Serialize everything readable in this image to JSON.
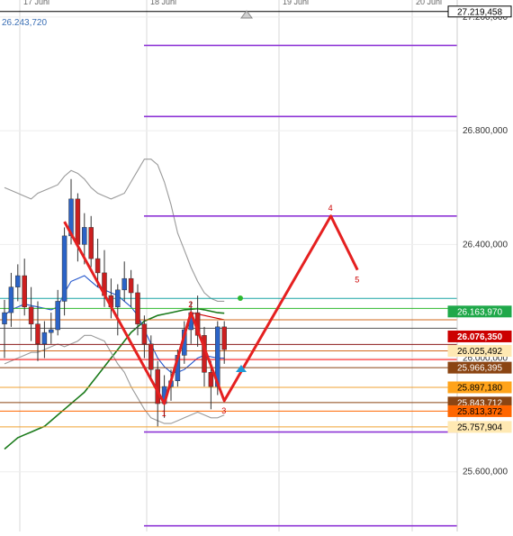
{
  "chart_data": {
    "type": "candlestick",
    "x_labels": [
      "17 Juni",
      "18 Juni",
      "19 Juni",
      "20 Juni"
    ],
    "y_axis": {
      "ylim": [
        25390000,
        27260000
      ],
      "tick_values": [
        27200000,
        26800000,
        26400000,
        26000000,
        25600000
      ],
      "tick_labels": [
        "27.200,000",
        "26.800,000",
        "26.400,000",
        "26.000,000",
        "25.600,000"
      ]
    },
    "top_left_value": "26.243,720",
    "candles": [
      {
        "o": 26120000,
        "h": 26205000,
        "l": 26000000,
        "c": 26160000
      },
      {
        "o": 26160000,
        "h": 26300000,
        "l": 26110000,
        "c": 26250000
      },
      {
        "o": 26250000,
        "h": 26330000,
        "l": 26200000,
        "c": 26290000
      },
      {
        "o": 26290000,
        "h": 26350000,
        "l": 26150000,
        "c": 26180000
      },
      {
        "o": 26180000,
        "h": 26250000,
        "l": 26060000,
        "c": 26120000
      },
      {
        "o": 26120000,
        "h": 26200000,
        "l": 25990000,
        "c": 26050000
      },
      {
        "o": 26050000,
        "h": 26130000,
        "l": 26000000,
        "c": 26090000
      },
      {
        "o": 26090000,
        "h": 26160000,
        "l": 26050000,
        "c": 26100000
      },
      {
        "o": 26100000,
        "h": 26240000,
        "l": 26080000,
        "c": 26200000
      },
      {
        "o": 26200000,
        "h": 26460000,
        "l": 26150000,
        "c": 26430000
      },
      {
        "o": 26430000,
        "h": 26630000,
        "l": 26400000,
        "c": 26560000
      },
      {
        "o": 26560000,
        "h": 26580000,
        "l": 26340000,
        "c": 26400000
      },
      {
        "o": 26400000,
        "h": 26510000,
        "l": 26330000,
        "c": 26460000
      },
      {
        "o": 26460000,
        "h": 26500000,
        "l": 26320000,
        "c": 26350000
      },
      {
        "o": 26350000,
        "h": 26420000,
        "l": 26250000,
        "c": 26300000
      },
      {
        "o": 26300000,
        "h": 26380000,
        "l": 26180000,
        "c": 26220000
      },
      {
        "o": 26220000,
        "h": 26280000,
        "l": 26140000,
        "c": 26180000
      },
      {
        "o": 26180000,
        "h": 26260000,
        "l": 26080000,
        "c": 26240000
      },
      {
        "o": 26240000,
        "h": 26340000,
        "l": 26200000,
        "c": 26280000
      },
      {
        "o": 26280000,
        "h": 26310000,
        "l": 26180000,
        "c": 26230000
      },
      {
        "o": 26230000,
        "h": 26260000,
        "l": 26080000,
        "c": 26120000
      },
      {
        "o": 26120000,
        "h": 26150000,
        "l": 26000000,
        "c": 26050000
      },
      {
        "o": 26050000,
        "h": 26080000,
        "l": 25920000,
        "c": 25960000
      },
      {
        "o": 25960000,
        "h": 25990000,
        "l": 25760000,
        "c": 25840000
      },
      {
        "o": 25840000,
        "h": 25940000,
        "l": 25790000,
        "c": 25900000
      },
      {
        "o": 25900000,
        "h": 25960000,
        "l": 25850000,
        "c": 25920000
      },
      {
        "o": 25920000,
        "h": 26030000,
        "l": 25900000,
        "c": 26010000
      },
      {
        "o": 26010000,
        "h": 26130000,
        "l": 25980000,
        "c": 26100000
      },
      {
        "o": 26100000,
        "h": 26200000,
        "l": 26050000,
        "c": 26160000
      },
      {
        "o": 26160000,
        "h": 26220000,
        "l": 26040000,
        "c": 26080000
      },
      {
        "o": 26080000,
        "h": 26110000,
        "l": 25900000,
        "c": 25950000
      },
      {
        "o": 25950000,
        "h": 25990000,
        "l": 25820000,
        "c": 25900000
      },
      {
        "o": 25900000,
        "h": 26130000,
        "l": 25870000,
        "c": 26110000
      },
      {
        "o": 26110000,
        "h": 26130000,
        "l": 25980000,
        "c": 26030000
      }
    ],
    "horizontal_lines": [
      {
        "value": 27219458,
        "color": "#000000"
      },
      {
        "value": 27100000,
        "color": "#8e35d6"
      },
      {
        "value": 26850000,
        "color": "#8e35d6"
      },
      {
        "value": 26500000,
        "color": "#8e35d6"
      },
      {
        "value": 26210000,
        "color": "#19a3a3"
      },
      {
        "value": 26175000,
        "color": "#2eb82e"
      },
      {
        "value": 26135000,
        "color": "#d2691e"
      },
      {
        "value": 26105000,
        "color": "#555555"
      },
      {
        "value": 26048000,
        "color": "#8b1a1a"
      },
      {
        "value": 26025492,
        "color": "#d2691e"
      },
      {
        "value": 25995000,
        "color": "#ff0000"
      },
      {
        "value": 25966395,
        "color": "#8b4513"
      },
      {
        "value": 25897180,
        "color": "#f0a030"
      },
      {
        "value": 25843712,
        "color": "#8b4513"
      },
      {
        "value": 25813372,
        "color": "#ff6600"
      },
      {
        "value": 25757904,
        "color": "#f0a030"
      },
      {
        "value": 25740000,
        "color": "#8e35d6"
      },
      {
        "value": 25410000,
        "color": "#8e35d6"
      }
    ],
    "price_labels": [
      {
        "text": "27.219,458",
        "value": 27219458,
        "bg": "#ffffff",
        "fg": "#000000",
        "border": "#000000"
      },
      {
        "text": "26.163,970",
        "value": 26163970,
        "bg": "#1fa84a",
        "fg": "#ffffff",
        "border": "#1fa84a"
      },
      {
        "text": "26.076,350",
        "value": 26076350,
        "bg": "#cc0000",
        "fg": "#ffffff",
        "border": "#cc0000"
      },
      {
        "text": "26.025,492",
        "value": 26025492,
        "bg": "#ffe9b3",
        "fg": "#000000",
        "border": "#ffe9b3"
      },
      {
        "text": "25.966,395",
        "value": 25966395,
        "bg": "#8b4513",
        "fg": "#ffffff",
        "border": "#8b4513"
      },
      {
        "text": "25.897,180",
        "value": 25897180,
        "bg": "#ffa31a",
        "fg": "#000000",
        "border": "#ffa31a"
      },
      {
        "text": "25.843,712",
        "value": 25843712,
        "bg": "#8b4513",
        "fg": "#ffffff",
        "border": "#8b4513"
      },
      {
        "text": "25.813,372",
        "value": 25813372,
        "bg": "#ff6600",
        "fg": "#000000",
        "border": "#ff6600"
      },
      {
        "text": "25.757,904",
        "value": 25757904,
        "bg": "#ffe9b3",
        "fg": "#000000",
        "border": "#ffe9b3"
      }
    ],
    "wave_pattern": {
      "color": "#e52020",
      "points": [
        {
          "label": "",
          "i": 9,
          "y": 26480000
        },
        {
          "label": "1",
          "i": 24,
          "y": 25840000
        },
        {
          "label": "2",
          "i": 28,
          "y": 26160000
        },
        {
          "label": "3",
          "i": 33,
          "y": 25850000
        },
        {
          "label": "4",
          "i": 49,
          "y": 26500000
        },
        {
          "label": "5",
          "i": 53,
          "y": 26310000
        }
      ]
    },
    "moving_averages": [
      {
        "color": "#1a7a1a",
        "values": [
          25680000,
          25700000,
          25720000,
          25730000,
          25740000,
          25750000,
          25760000,
          25780000,
          25800000,
          25820000,
          25840000,
          25860000,
          25880000,
          25910000,
          25940000,
          25970000,
          26000000,
          26030000,
          26060000,
          26090000,
          26110000,
          26130000,
          26140000,
          26150000,
          26155000,
          26160000,
          26165000,
          26170000,
          26172000,
          26174000,
          26170000,
          26165000,
          26160000,
          26158000
        ]
      },
      {
        "color": "#cc0000",
        "values": [
          null,
          null,
          null,
          null,
          null,
          null,
          null,
          null,
          null,
          null,
          null,
          null,
          null,
          null,
          null,
          null,
          null,
          null,
          null,
          null,
          null,
          null,
          null,
          null,
          null,
          null,
          null,
          null,
          26160000,
          26155000,
          26150000,
          26145000,
          26140000,
          26135000
        ]
      },
      {
        "color": "#2255cc",
        "values": [
          26150000,
          26170000,
          26180000,
          26190000,
          26185000,
          26180000,
          26175000,
          26170000,
          26180000,
          26230000,
          26270000,
          26280000,
          26290000,
          26270000,
          26250000,
          26240000,
          26230000,
          26220000,
          26200000,
          26180000,
          26150000,
          26100000,
          26050000,
          26000000,
          25970000,
          25950000,
          25950000,
          25960000,
          25980000,
          26000000,
          26010000,
          26005000,
          26000000,
          26000000
        ]
      },
      {
        "color": "#9a9a9a",
        "values": [
          26600000,
          26590000,
          26580000,
          26570000,
          26560000,
          26580000,
          26590000,
          26600000,
          26610000,
          26640000,
          26660000,
          26650000,
          26630000,
          26600000,
          26580000,
          26570000,
          26560000,
          26570000,
          26580000,
          26620000,
          26660000,
          26700000,
          26700000,
          26680000,
          26620000,
          26540000,
          26440000,
          26380000,
          26320000,
          26270000,
          26230000,
          26210000,
          26200000,
          26200000
        ]
      },
      {
        "color": "#9a9a9a",
        "values": [
          25980000,
          25990000,
          26000000,
          26010000,
          26020000,
          26020000,
          26030000,
          26040000,
          26050000,
          26040000,
          26050000,
          26060000,
          26080000,
          26080000,
          26070000,
          26060000,
          26020000,
          25980000,
          25950000,
          25900000,
          25860000,
          25820000,
          25790000,
          25780000,
          25770000,
          25770000,
          25780000,
          25790000,
          25800000,
          25810000,
          25800000,
          25790000,
          25790000,
          25800000
        ]
      }
    ]
  }
}
